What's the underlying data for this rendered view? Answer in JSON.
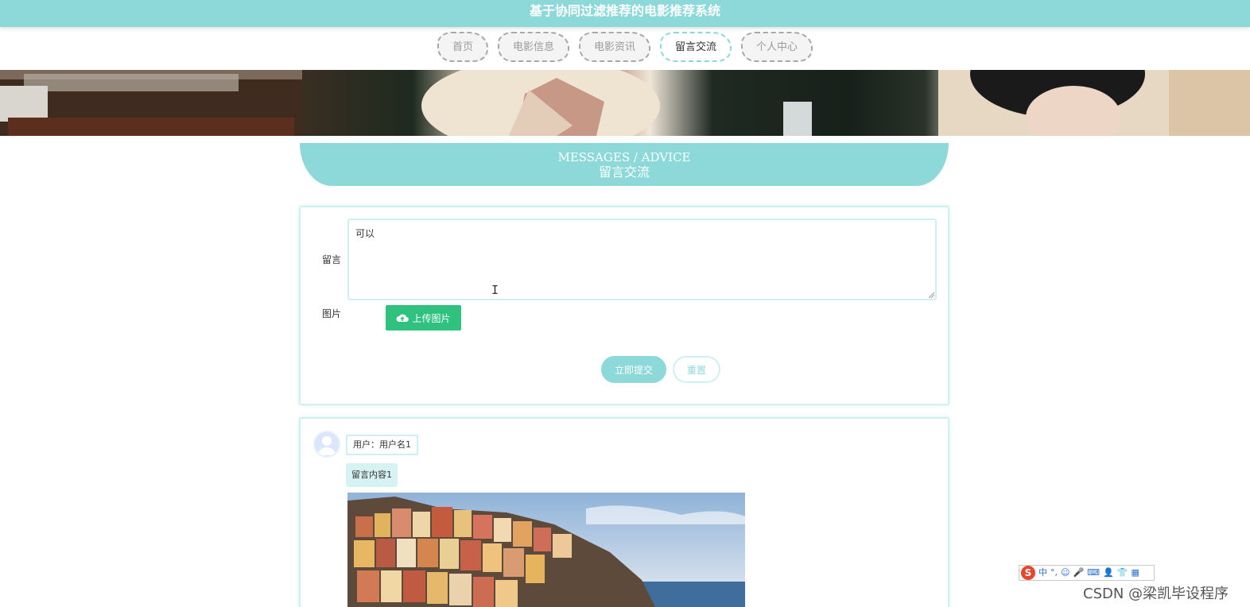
{
  "site": {
    "title": "基于协同过滤推荐的电影推荐系统"
  },
  "nav": {
    "items": [
      "首页",
      "电影信息",
      "电影资讯",
      "留言交流",
      "个人中心"
    ],
    "active_index": 3
  },
  "section": {
    "title_en": "MESSAGES / ADVICE",
    "title_cn": "留言交流"
  },
  "form": {
    "message_label": "留言",
    "message_value": "可以",
    "picture_label": "图片",
    "upload_label": "上传图片",
    "submit_label": "立即提交",
    "reset_label": "重置"
  },
  "messages": [
    {
      "user": "用户：用户名1",
      "content": "留言内容1"
    }
  ],
  "ime": {
    "items": [
      "S",
      "中",
      "°,",
      "☺",
      "🎤",
      "⌨",
      "👤",
      "👕",
      "▦"
    ]
  },
  "watermark": "CSDN @梁凯毕设程序",
  "colors": {
    "accent": "#8dd8d9",
    "accent_light": "#cfeff1",
    "upload_green": "#2ec27e"
  }
}
